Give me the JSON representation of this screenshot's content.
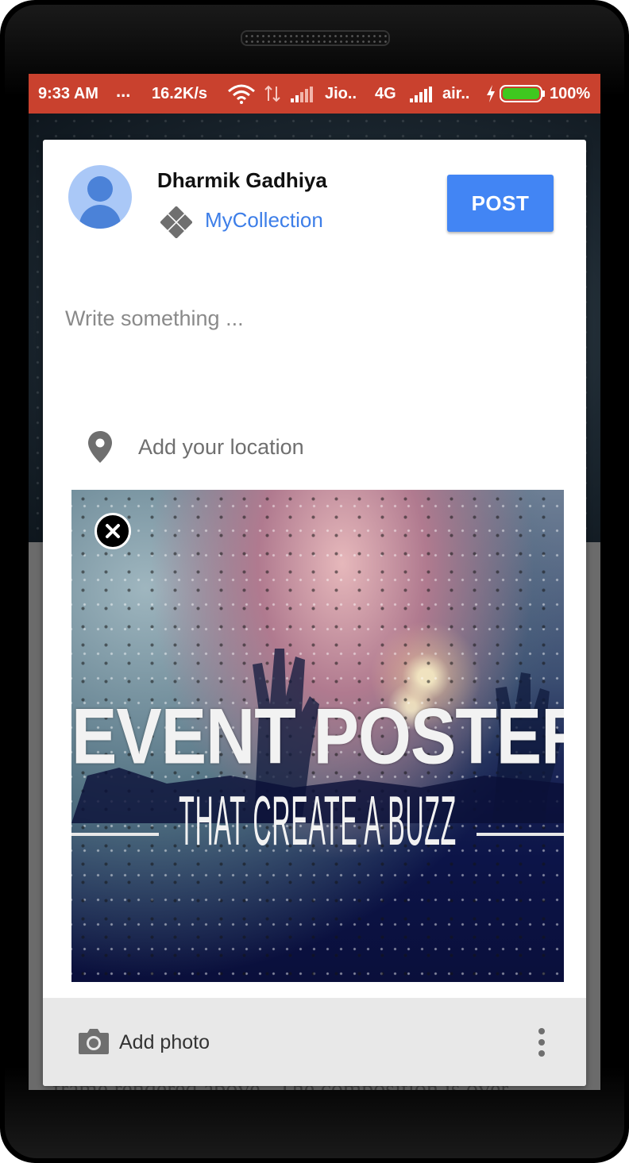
{
  "status_bar": {
    "time": "9:33 AM",
    "dots": "...",
    "speed": "16.2K/s",
    "carrier1": "Jio..",
    "network": "4G",
    "carrier2": "air..",
    "battery": "100%"
  },
  "composer": {
    "user_name": "Dharmik Gadhiya",
    "collection": "MyCollection",
    "post_label": "POST",
    "text_placeholder": "Write something ...",
    "location_label": "Add your location"
  },
  "attached_image": {
    "headline": "EVENT POSTERS",
    "tagline": "THAT CREATE A BUZZ"
  },
  "bottom_bar": {
    "add_photo_label": "Add photo"
  },
  "colors": {
    "status_bar": "#c9412e",
    "accent": "#4285f4",
    "link": "#3d7ee8"
  }
}
